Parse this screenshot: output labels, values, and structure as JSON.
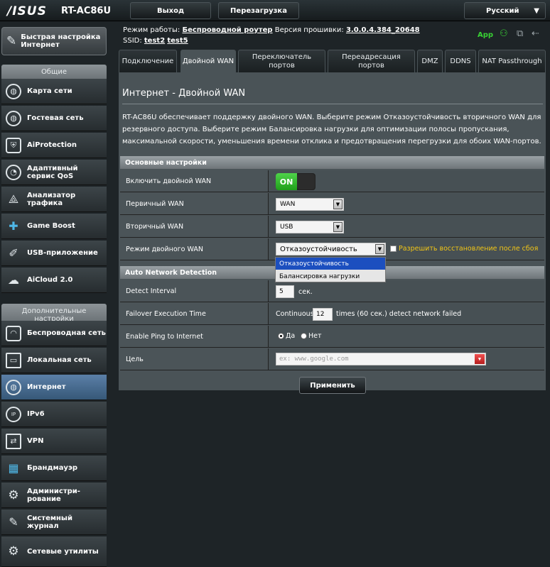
{
  "header": {
    "logo": "/ISUS",
    "model": "RT-AC86U",
    "logout": "Выход",
    "reboot": "Перезагрузка",
    "language": "Русский"
  },
  "status": {
    "mode_label": "Режим работы:",
    "mode_value": "Беспроводной роутер",
    "fw_label": "Версия прошивки:",
    "fw_value": "3.0.0.4.384_20648",
    "ssid_label": "SSID:",
    "ssid_1": "test2",
    "ssid_2": "test5",
    "app": "App"
  },
  "sidebar": {
    "quick_setup": "Быстрая настройка Интернет",
    "general_head": "Общие",
    "general": [
      {
        "label": "Карта сети",
        "icon": "globe-icon"
      },
      {
        "label": "Гостевая сеть",
        "icon": "guest-icon"
      },
      {
        "label": "AiProtection",
        "icon": "shield-icon"
      },
      {
        "label": "Адаптивный сервис QoS",
        "icon": "gauge-icon"
      },
      {
        "label": "Анализатор трафика",
        "icon": "pulse-icon"
      },
      {
        "label": "Game Boost",
        "icon": "gamepad-icon"
      },
      {
        "label": "USB-приложение",
        "icon": "usb-icon"
      },
      {
        "label": "AiCloud 2.0",
        "icon": "cloud-icon"
      }
    ],
    "advanced_head": "Дополнительные настройки",
    "advanced": [
      {
        "label": "Беспроводная сеть",
        "icon": "wifi-icon"
      },
      {
        "label": "Локальная сеть",
        "icon": "monitor-icon"
      },
      {
        "label": "Интернет",
        "icon": "globe-icon"
      },
      {
        "label": "IPv6",
        "icon": "ipv6-icon"
      },
      {
        "label": "VPN",
        "icon": "vpn-icon"
      },
      {
        "label": "Брандмауэр",
        "icon": "firewall-icon"
      },
      {
        "label": "Администри- рование",
        "icon": "admin-icon"
      },
      {
        "label": "Системный журнал",
        "icon": "log-icon"
      },
      {
        "label": "Сетевые утилиты",
        "icon": "tools-icon"
      }
    ]
  },
  "tabs": [
    "Подключение",
    "Двойной WAN",
    "Переключатель портов",
    "Переадресация портов",
    "DMZ",
    "DDNS",
    "NAT Passthrough"
  ],
  "main": {
    "title": "Интернет - Двойной WAN",
    "description": "RT-AC86U обеспечивает поддержку двойного WAN. Выберите режим Отказоустойчивость вторичного WAN для резервного доступа. Выберите режим Балансировка нагрузки для оптимизации полосы пропускания, максимальной скорости, уменьшения времени отклика и предотвращения перегрузки для обоих WAN-портов.",
    "basic_head": "Основные настройки",
    "enable_label": "Включить двойной WAN",
    "toggle_on": "ON",
    "primary_label": "Первичный WAN",
    "primary_value": "WAN",
    "secondary_label": "Вторичный WAN",
    "secondary_value": "USB",
    "mode_label": "Режим двойного WAN",
    "mode_value": "Отказоустойчивость",
    "failback": "Разрешить восстановление после сбоя",
    "mode_options": [
      "Отказоустойчивость",
      "Балансировка нагрузки"
    ],
    "and_head": "Auto Network Detection",
    "interval_label": "Detect Interval",
    "interval_value": "5",
    "interval_unit": "сек.",
    "failover_label": "Failover Execution Time",
    "failover_prefix": "Continuous",
    "failover_value": "12",
    "failover_suffix": "times (60 сек.) detect network failed",
    "ping_label": "Enable Ping to Internet",
    "ping_yes": "Да",
    "ping_no": "Нет",
    "target_label": "Цель",
    "target_placeholder": "ex: www.google.com",
    "apply": "Применить"
  }
}
